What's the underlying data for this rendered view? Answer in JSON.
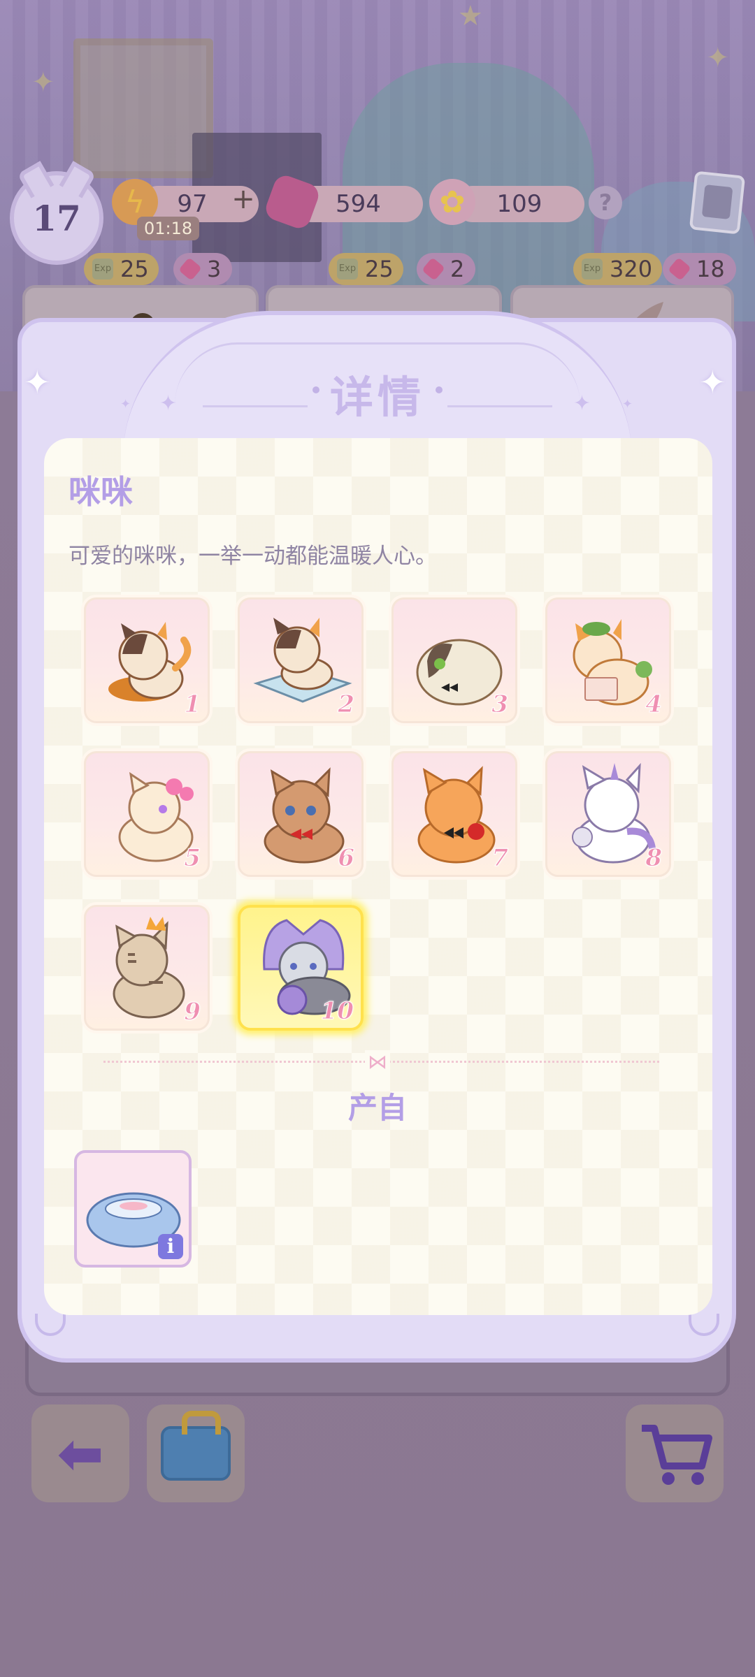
{
  "hud": {
    "level": "17",
    "energy": "97",
    "energy_plus": "+",
    "energy_timer": "01:18",
    "gems": "594",
    "flowers": "109",
    "help": "?"
  },
  "shop_row": {
    "prices": [
      {
        "exp": "25",
        "gems": "3"
      },
      {
        "exp": "25",
        "gems": "2"
      },
      {
        "exp": "320",
        "gems": "18"
      }
    ],
    "exp_icon_text": "Exp"
  },
  "dialog": {
    "title": "详情",
    "item_name": "咪咪",
    "description": "可爱的咪咪，一举一动都能温暖人心。",
    "produced_label": "产自",
    "selected_level": 10,
    "levels": [
      "1",
      "2",
      "3",
      "4",
      "5",
      "6",
      "7",
      "8",
      "9",
      "10"
    ],
    "info_badge": "i"
  },
  "colors": {
    "accent": "#b39ee6",
    "highlight": "#fff06a",
    "number_pink": "#ef8fb1"
  },
  "icons": {
    "energy": "lightning-icon",
    "gem": "gem-icon",
    "flower": "rainbow-flower-icon",
    "back": "back-arrow-icon",
    "bag": "toolbox-icon",
    "cart": "cart-icon"
  }
}
